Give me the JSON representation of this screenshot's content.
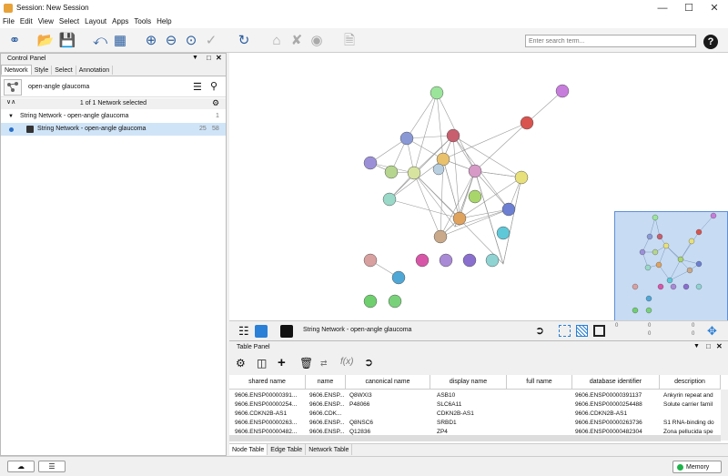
{
  "window": {
    "title": "Session: New Session"
  },
  "menu": [
    "File",
    "Edit",
    "View",
    "Select",
    "Layout",
    "Apps",
    "Tools",
    "Help"
  ],
  "search": {
    "placeholder": "Enter search term..."
  },
  "control_panel": {
    "title": "Control Panel",
    "tabs": [
      "Network",
      "Style",
      "Select",
      "Annotation"
    ],
    "query": "open-angle glaucoma",
    "selection_status": "1 of 1 Network selected",
    "tree": {
      "root": {
        "label": "String Network - open-angle glaucoma",
        "count": "1"
      },
      "child": {
        "label": "String Network - open-angle glaucoma",
        "nodes": "25",
        "edges": "58"
      }
    }
  },
  "canvas": {
    "network_name": "String Network - open-angle glaucoma",
    "counters": [
      "0",
      "0",
      "0",
      "0",
      "0",
      "0"
    ]
  },
  "table_panel": {
    "title": "Table Panel",
    "columns": [
      "shared name",
      "name",
      "canonical name",
      "display name",
      "full name",
      "database identifier",
      "description"
    ],
    "rows": [
      [
        "9606.ENSP00000391...",
        "9606.ENSP...",
        "Q8WXI3",
        "ASB10",
        "",
        "9606.ENSP00000391137",
        "Ankyrin repeat and"
      ],
      [
        "9606.ENSP00000254...",
        "9606.ENSP...",
        "P48066",
        "SLC6A11",
        "",
        "9606.ENSP00000254488",
        "Solute carrier famil"
      ],
      [
        "9606.CDKN2B-AS1",
        "9606.CDK...",
        "",
        "CDKN2B-AS1",
        "",
        "9606.CDKN2B-AS1",
        ""
      ],
      [
        "9606.ENSP00000263...",
        "9606.ENSP...",
        "Q8NSC6",
        "SRBD1",
        "",
        "9606.ENSP00000263736",
        "S1 RNA-binding do"
      ],
      [
        "9606.ENSP00000482...",
        "9606.ENSP...",
        "Q12836",
        "ZP4",
        "",
        "9606.ENSP00000482304",
        "Zona pellucida spe"
      ]
    ],
    "tabs": [
      "Node Table",
      "Edge Table",
      "Network Table"
    ]
  },
  "status": {
    "memory": "Memory"
  },
  "colors": {
    "accent": "#2a5d9f",
    "selection": "#cfe4f7",
    "minimap": "#c7dbf3",
    "memory_ok": "#1db34a"
  }
}
